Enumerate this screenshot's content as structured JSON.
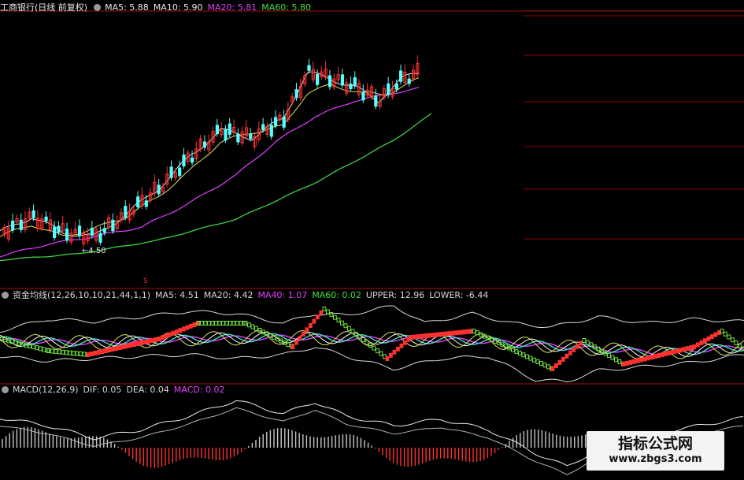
{
  "main_panel": {
    "title": "工商银行(日线 前复权)",
    "ma5": "MA5: 5.88",
    "ma10": "MA10: 5.90",
    "ma20": "MA20: 5.81",
    "ma60": "MA60: 5.80",
    "low_label": "4.50"
  },
  "fund_panel": {
    "title": "资金均线(12,26,10,10,21,44,1,1)",
    "ma5": "MA5: 4.51",
    "ma20": "MA20: 4.42",
    "ma40": "MA40: 1.07",
    "ma60": "MA60: 0.02",
    "upper": "UPPER: 12.96",
    "lower": "LOWER: -6.44",
    "marker": "S"
  },
  "macd_panel": {
    "title": "MACD(12,26,9)",
    "dif": "DIF: 0.05",
    "dea": "DEA: 0.04",
    "macd": "MACD: 0.02"
  },
  "watermark": {
    "line1": "指标公式网",
    "line2": "www.zbgs3.com"
  },
  "colors": {
    "background": "#000000",
    "up": "#ff3030",
    "down": "#54ffff",
    "ma5": "#e8e8e8",
    "ma10": "#e0e060",
    "ma20": "#e040ff",
    "ma60": "#40d040",
    "grid": "#8b0000"
  }
}
